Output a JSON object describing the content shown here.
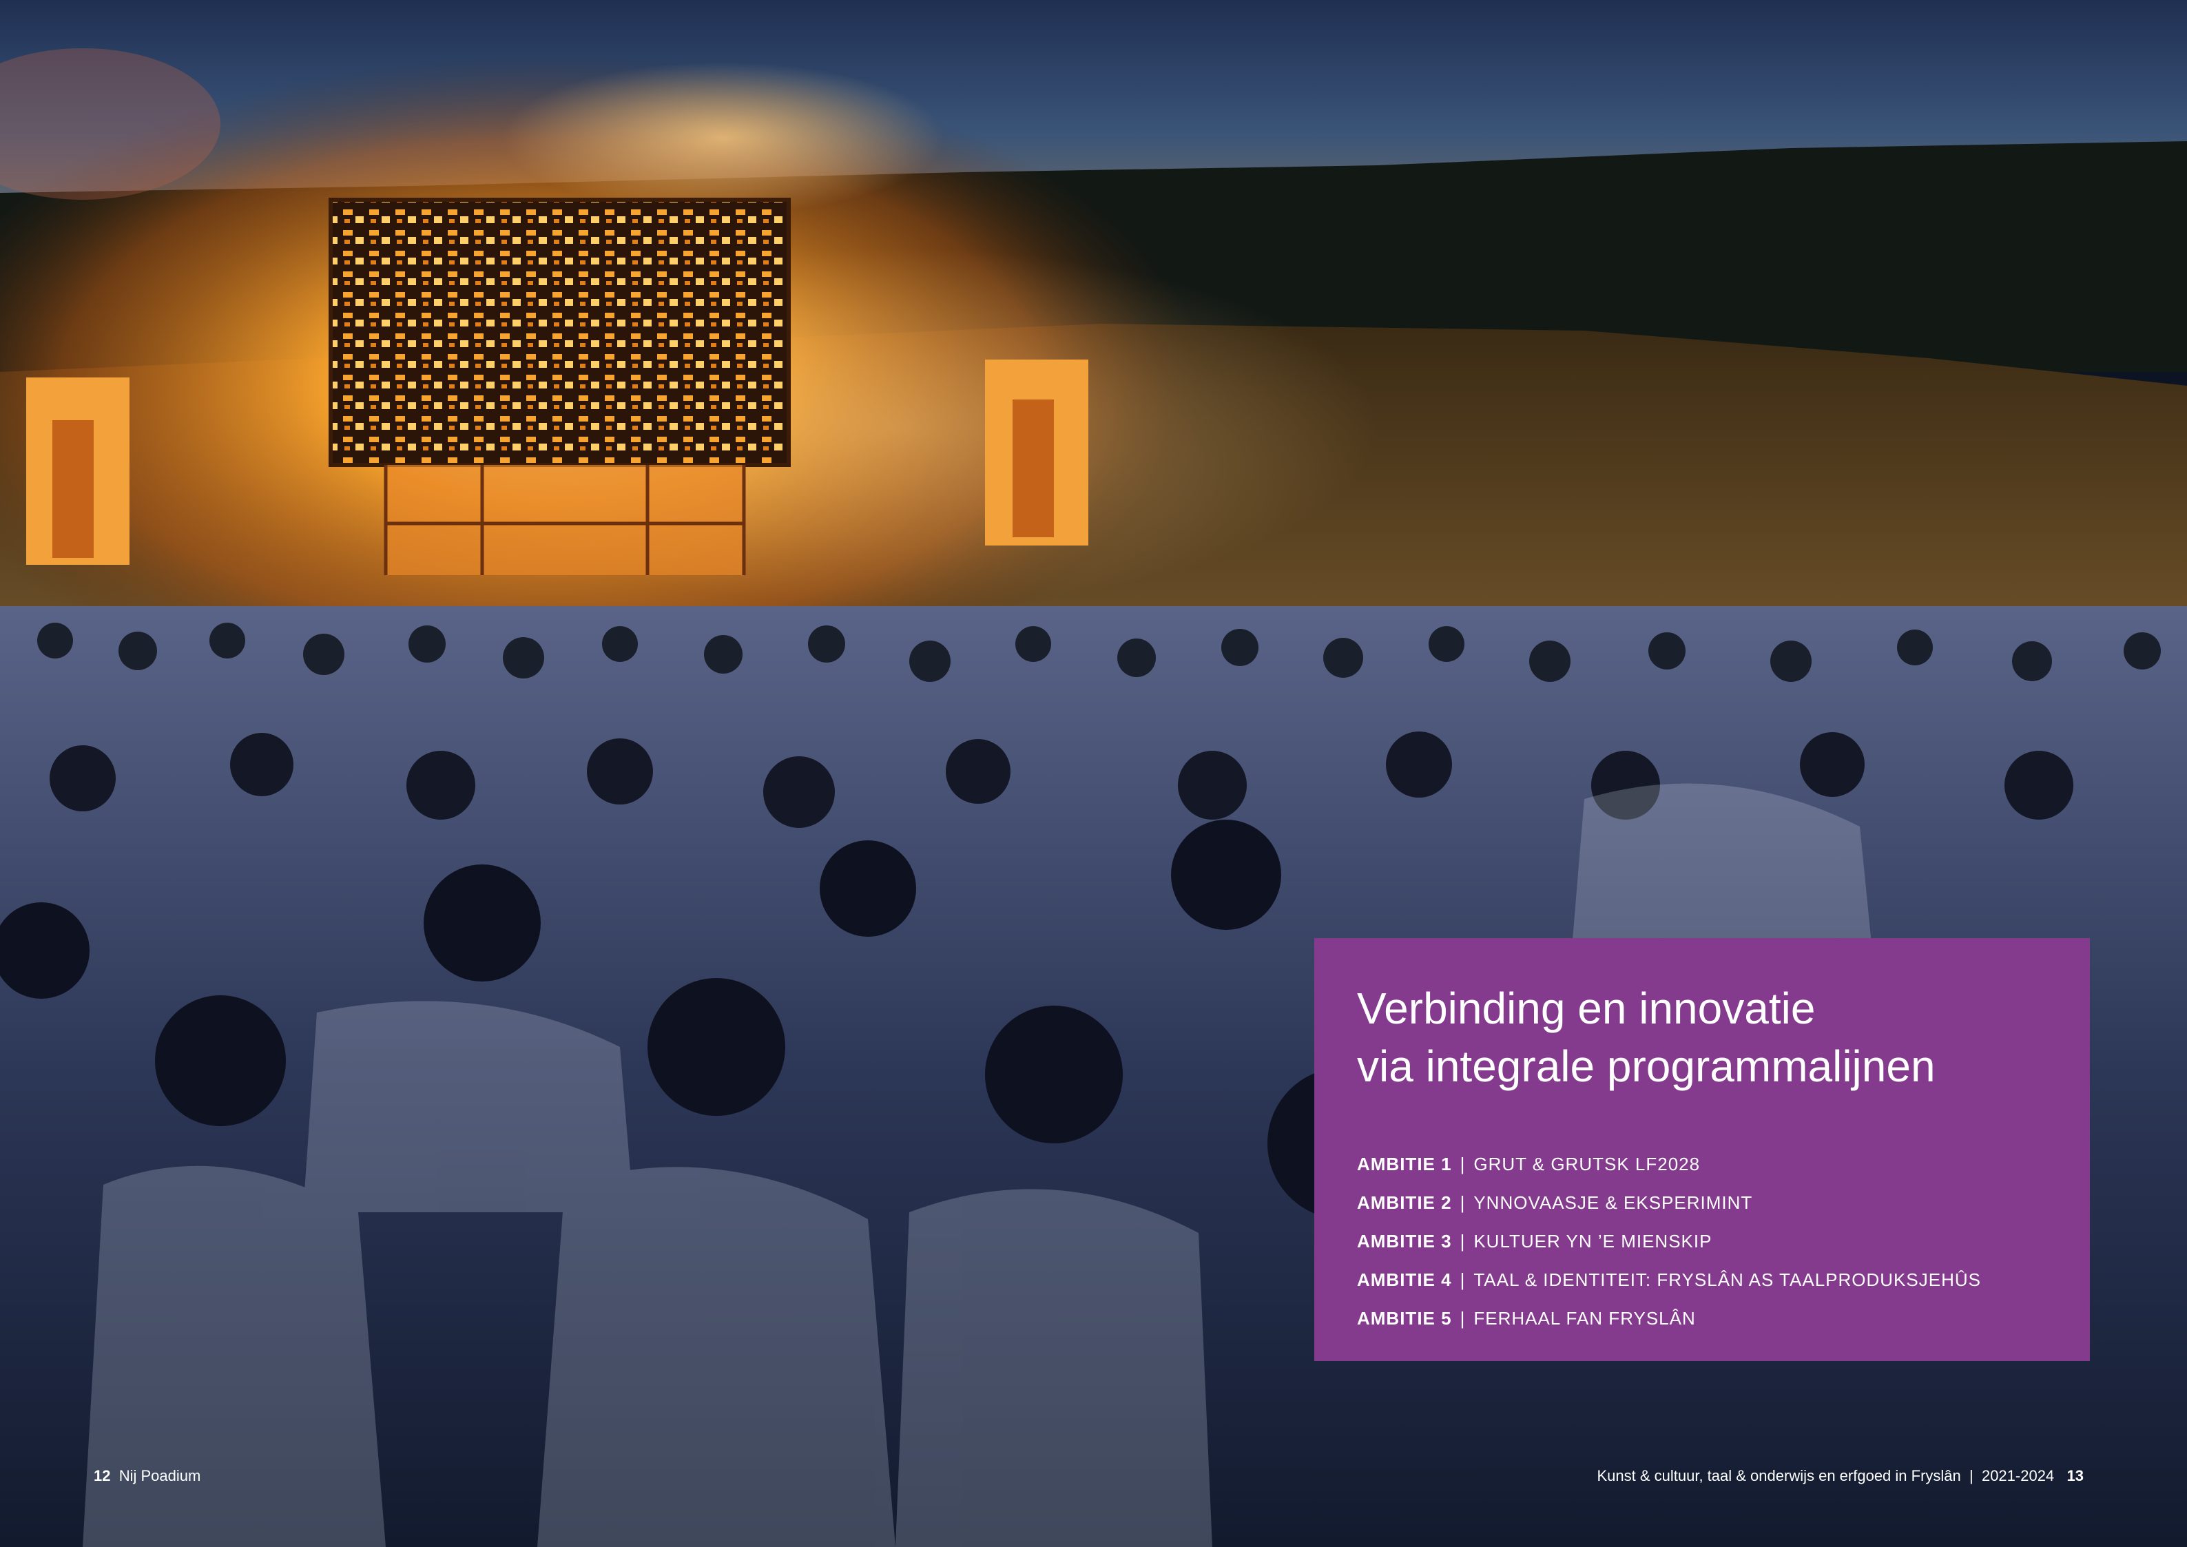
{
  "panel": {
    "title_line1": "Verbinding en innovatie",
    "title_line2": "via integrale programmalijnen",
    "ambities": [
      {
        "label": "AMBITIE 1",
        "text": "GRUT & GRUTSK LF2028"
      },
      {
        "label": "AMBITIE 2",
        "text": "YNNOVAASJE & EKSPERIMINT"
      },
      {
        "label": "AMBITIE 3",
        "text": "KULTUER YN ’E MIENSKIP"
      },
      {
        "label": "AMBITIE 4",
        "text": "TAAL & IDENTITEIT: FRYSLÂN AS TAALPRODUKSJEHÛS"
      },
      {
        "label": "AMBITIE 5",
        "text": "FERHAAL FAN FRYSLÂN"
      }
    ],
    "separator": "|"
  },
  "footer": {
    "left_page": "12",
    "left_title": "Nij Poadium",
    "right_title": "Kunst & cultuur, taal & onderwijs en erfgoed in Fryslân",
    "right_separator": "|",
    "right_years": "2021-2024",
    "right_page": "13"
  },
  "colors": {
    "panel": "#843a8d",
    "sky": "#2c3f63",
    "fire": "#f7a430",
    "crowd": "#2a3550"
  }
}
